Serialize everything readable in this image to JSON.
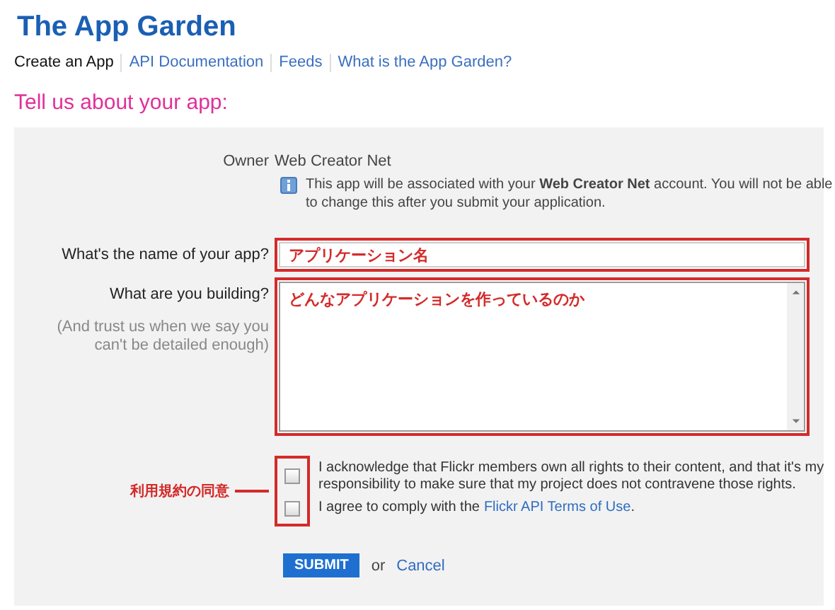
{
  "header": {
    "title": "The App Garden",
    "nav": [
      {
        "label": "Create an App",
        "selected": true
      },
      {
        "label": "API Documentation",
        "selected": false
      },
      {
        "label": "Feeds",
        "selected": false
      },
      {
        "label": "What is the App Garden?",
        "selected": false
      }
    ]
  },
  "heading": "Tell us about your app:",
  "form": {
    "owner_label": "Owner",
    "owner_value": "Web Creator Net",
    "notice": "This app will be associated with your **Web Creator Net** account. You will not be able to change this after you submit your application.",
    "name_label": "What's the name of your app?",
    "name_value": "アプリケーション名",
    "building_label": "What are you building?",
    "building_hint": "(And trust us when we say you can't be detailed enough)",
    "building_value": "どんなアプリケーションを作っているのか",
    "annotation": "利用規約の同意",
    "agreements": [
      {
        "text": "I acknowledge that Flickr members own all rights to their content, and that it's my responsibility to make sure that my project does not contravene those rights.",
        "checked": false
      },
      {
        "text": "I agree to comply with the",
        "link": "Flickr API Terms of Use",
        "suffix": ".",
        "checked": false
      }
    ],
    "submit": "SUBMIT",
    "or": "or",
    "cancel": "Cancel"
  }
}
